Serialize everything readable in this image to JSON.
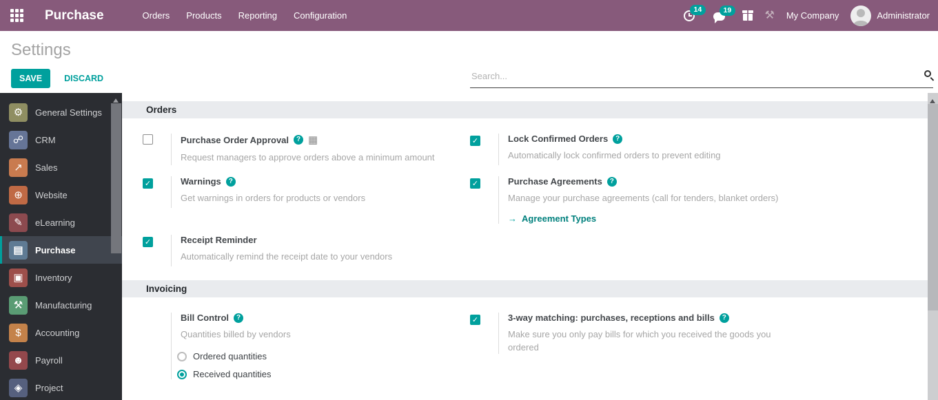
{
  "colors": {
    "accent": "#00a09d",
    "header_bg": "#875a7b",
    "sidebar_bg": "#2b2d32",
    "sidebar_active_bg": "#40454e",
    "section_band": "#e9ebee"
  },
  "header": {
    "app_name": "Purchase",
    "menu": [
      {
        "label": "Orders"
      },
      {
        "label": "Products"
      },
      {
        "label": "Reporting"
      },
      {
        "label": "Configuration"
      }
    ],
    "activity_count": "14",
    "message_count": "19",
    "company": "My Company",
    "user": "Administrator",
    "icons": [
      "apps-grid-icon",
      "clock-icon",
      "chat-bubble-icon",
      "gift-icon",
      "wrench-icon",
      "avatar"
    ]
  },
  "control_panel": {
    "title": "Settings",
    "save_label": "SAVE",
    "discard_label": "DISCARD",
    "search_placeholder": "Search..."
  },
  "sidebar": {
    "items": [
      {
        "label": "General Settings",
        "icon": "gear-icon",
        "color": "#8f8e62",
        "active": false
      },
      {
        "label": "CRM",
        "icon": "handshake-icon",
        "color": "#667597",
        "active": false
      },
      {
        "label": "Sales",
        "icon": "sales-chart-icon",
        "color": "#c97b4f",
        "active": false
      },
      {
        "label": "Website",
        "icon": "globe-icon",
        "color": "#c06a45",
        "active": false
      },
      {
        "label": "eLearning",
        "icon": "presentation-icon",
        "color": "#8c4a4f",
        "active": false
      },
      {
        "label": "Purchase",
        "icon": "card-icon",
        "color": "#5f7b94",
        "active": true
      },
      {
        "label": "Inventory",
        "icon": "box-icon",
        "color": "#9d4f4b",
        "active": false
      },
      {
        "label": "Manufacturing",
        "icon": "wrench-icon",
        "color": "#5a9c74",
        "active": false
      },
      {
        "label": "Accounting",
        "icon": "invoice-icon",
        "color": "#c4824a",
        "active": false
      },
      {
        "label": "Payroll",
        "icon": "employee-icon",
        "color": "#94484c",
        "active": false
      },
      {
        "label": "Project",
        "icon": "puzzle-icon",
        "color": "#56607e",
        "active": false
      }
    ]
  },
  "sections": [
    {
      "title": "Orders",
      "rows": [
        [
          {
            "id": "purchase-order-approval",
            "checkbox": "unchecked",
            "label": "Purchase Order Approval",
            "help": true,
            "enterprise_icon": true,
            "desc": "Request managers to approve orders above a minimum amount"
          },
          {
            "id": "lock-confirmed-orders",
            "checkbox": "checked",
            "label": "Lock Confirmed Orders",
            "help": true,
            "desc": "Automatically lock confirmed orders to prevent editing"
          }
        ],
        [
          {
            "id": "warnings",
            "checkbox": "checked",
            "label": "Warnings",
            "help": true,
            "desc": "Get warnings in orders for products or vendors"
          },
          {
            "id": "purchase-agreements",
            "checkbox": "checked",
            "label": "Purchase Agreements",
            "help": true,
            "desc": "Manage your purchase agreements (call for tenders, blanket orders)",
            "link": {
              "label": "Agreement Types",
              "arrow": "arrow-right-icon"
            }
          }
        ],
        [
          {
            "id": "receipt-reminder",
            "checkbox": "checked",
            "label": "Receipt Reminder",
            "help": false,
            "desc": "Automatically remind the receipt date to your vendors"
          },
          null
        ]
      ]
    },
    {
      "title": "Invoicing",
      "rows": [
        [
          {
            "id": "bill-control",
            "checkbox": "none",
            "label": "Bill Control",
            "help": true,
            "desc": "Quantities billed by vendors",
            "radios": [
              {
                "label": "Ordered quantities",
                "selected": false
              },
              {
                "label": "Received quantities",
                "selected": true
              }
            ]
          },
          {
            "id": "three-way-matching",
            "checkbox": "checked",
            "label": "3-way matching: purchases, receptions and bills",
            "help": true,
            "desc": "Make sure you only pay bills for which you received the goods you ordered"
          }
        ]
      ]
    }
  ]
}
